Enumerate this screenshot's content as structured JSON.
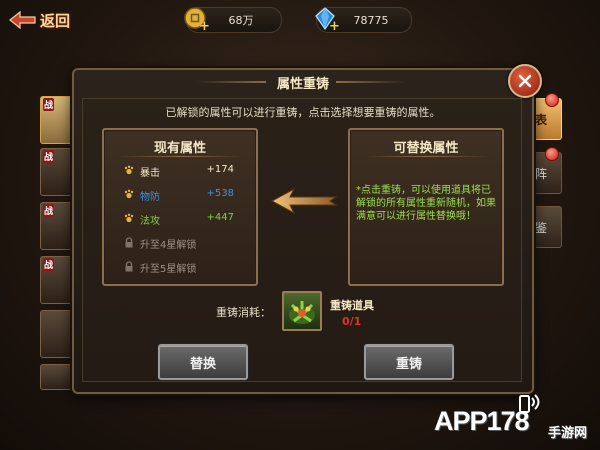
{
  "topbar": {
    "back_label": "返回",
    "gold_value": "68万",
    "gem_value": "78775"
  },
  "dialog": {
    "title": "属性重铸",
    "instruction": "已解锁的属性可以进行重铸，点击选择想要重铸的属性。",
    "current_panel": {
      "title": "现有属性",
      "attributes": [
        {
          "name": "暴击",
          "value": "+174",
          "color": "#f4e7c5"
        },
        {
          "name": "物防",
          "value": "+538",
          "color": "#3f8fe6"
        },
        {
          "name": "法攻",
          "value": "+447",
          "color": "#7fd23a"
        }
      ],
      "locked": [
        "升至4星解锁",
        "升至5星解锁"
      ]
    },
    "replace_panel": {
      "title": "可替换属性",
      "description": "*点击重铸，可以使用道具将已解锁的所有属性重新随机，如果满意可以进行属性替换哦！"
    },
    "cost": {
      "label": "重铸消耗：",
      "item_name": "重铸道具",
      "item_count": "0/1"
    },
    "buttons": {
      "replace": "替换",
      "recast": "重铸"
    }
  },
  "background": {
    "side_tag": "战",
    "right_tabs": [
      "表",
      "阵",
      "鉴"
    ]
  },
  "watermark": {
    "main": "APP178",
    "sub": "手游网"
  }
}
